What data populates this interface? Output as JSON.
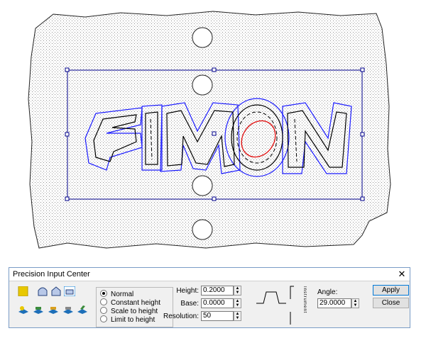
{
  "artwork": {
    "text": "SIMON",
    "colors": {
      "outline": "#1c1cff",
      "toolpath": "#000000",
      "highlight": "#e01818",
      "selection": "#00008b",
      "material": "#000000"
    }
  },
  "panel": {
    "title": "Precision Input Center",
    "close_glyph": "✕",
    "shape_icons": [
      "solid-square-icon",
      "round-bevel-icon",
      "peak-bevel-icon",
      "flat-bevel-icon"
    ],
    "tool_icons": [
      "cut-tool-1-icon",
      "cut-tool-2-icon",
      "cut-tool-3-icon",
      "cut-tool-4-icon",
      "cut-tool-5-icon"
    ],
    "height_modes": [
      {
        "label": "Normal",
        "selected": true
      },
      {
        "label": "Constant height",
        "selected": false
      },
      {
        "label": "Scale to height",
        "selected": false
      },
      {
        "label": "Limit to height",
        "selected": false
      }
    ],
    "fields": {
      "height": {
        "label": "Height:",
        "value": "0.2000"
      },
      "base": {
        "label": "Base:",
        "value": "0.0000"
      },
      "resolution": {
        "label": "Resolution:",
        "value": "50"
      },
      "angle": {
        "label": "Angle:",
        "value": "29.0000"
      }
    },
    "vertical_label": "Instrument",
    "buttons": {
      "apply": "Apply",
      "close": "Close"
    },
    "accent": "#e8c800"
  }
}
